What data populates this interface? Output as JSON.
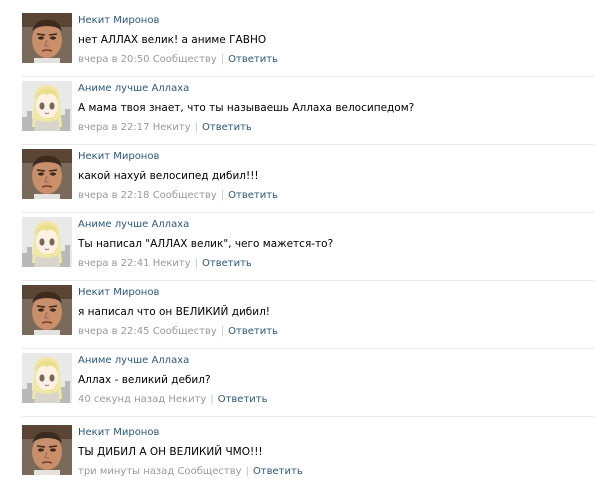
{
  "comments": [
    {
      "author": "Некит Миронов",
      "avatar": "male",
      "text": "нет АЛЛАХ велик! а аниме ГАВНО",
      "time": "вчера в 20:50",
      "target": "Сообществу",
      "reply": "Ответить"
    },
    {
      "author": "Аниме лучше Аллаха",
      "avatar": "anime",
      "text": "А мама твоя знает, что ты называешь Аллаха велосипедом?",
      "time": "вчера в 22:17",
      "target": "Некиту",
      "reply": "Ответить"
    },
    {
      "author": "Некит Миронов",
      "avatar": "male",
      "text": "какой нахуй велосипед дибил!!!",
      "time": "вчера в 22:18",
      "target": "Сообществу",
      "reply": "Ответить"
    },
    {
      "author": "Аниме лучше Аллаха",
      "avatar": "anime",
      "text": "Ты написал \"АЛЛАХ велик\", чего мажется-то?",
      "time": "вчера в 22:41",
      "target": "Некиту",
      "reply": "Ответить"
    },
    {
      "author": "Некит Миронов",
      "avatar": "male",
      "text": "я написал что он ВЕЛИКИЙ дибил!",
      "time": "вчера в 22:45",
      "target": "Сообществу",
      "reply": "Ответить"
    },
    {
      "author": "Аниме лучше Аллаха",
      "avatar": "anime",
      "text": "Аллах - великий дебил?",
      "time": "40 секунд назад",
      "target": "Некиту",
      "reply": "Ответить"
    },
    {
      "author": "Некит Миронов",
      "avatar": "male",
      "text": "ТЫ ДИБИЛ А ОН ВЕЛИКИЙ ЧМО!!!",
      "time": "три минуты назад",
      "target": "Сообществу",
      "reply": "Ответить"
    }
  ],
  "colors": {
    "link": "#2b587a",
    "meta": "#999999",
    "divider": "#e7e8ec"
  }
}
